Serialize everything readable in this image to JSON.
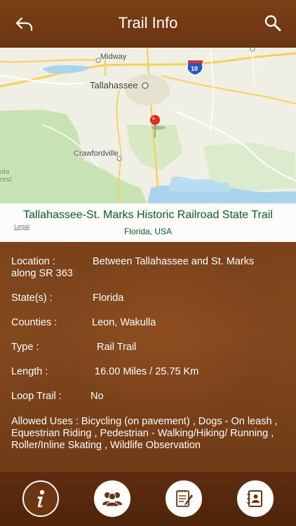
{
  "header": {
    "title": "Trail Info",
    "back_icon": "back-arrow-icon",
    "search_icon": "search-icon"
  },
  "map": {
    "labels": {
      "midway": "Midway",
      "tallahassee": "Tallahassee",
      "crawfordville": "Crawfordville",
      "park_a": "ola",
      "park_b": "rest",
      "highway": "10"
    },
    "legal": "Legal",
    "trail_name": "Tallahassee-St. Marks Historic Railroad State Trail",
    "trail_location": "Florida, USA"
  },
  "info": {
    "location_label": "Location  :",
    "location_value": "Between Tallahassee and St. Marks",
    "location_value_2": "along SR 363",
    "states_label": "State(s)  :",
    "states_value": "Florida",
    "counties_label": "Counties  :",
    "counties_value": "Leon, Wakulla",
    "type_label": "Type  :",
    "type_value": "Rail Trail",
    "length_label": "Length  :",
    "length_value": "16.00 Miles / 25.75 Km",
    "loop_label": "Loop Trail  :",
    "loop_value": "No",
    "uses_text": "Allowed Uses  : Bicycling (on pavement) , Dogs - On leash , Equestrian  Riding , Pedestrian - Walking/Hiking/ Running , Roller/Inline Skating , Wildlife Observation"
  },
  "tabs": [
    {
      "name": "info",
      "icon": "info-icon",
      "active": true
    },
    {
      "name": "community",
      "icon": "people-icon",
      "active": false
    },
    {
      "name": "notes",
      "icon": "notepad-icon",
      "active": false
    },
    {
      "name": "contacts",
      "icon": "address-book-icon",
      "active": false
    }
  ],
  "colors": {
    "header_bg": "#7a3f14",
    "content_bg": "#7b4319",
    "trail_name": "#0a5b2a",
    "pin": "#e8261c"
  }
}
